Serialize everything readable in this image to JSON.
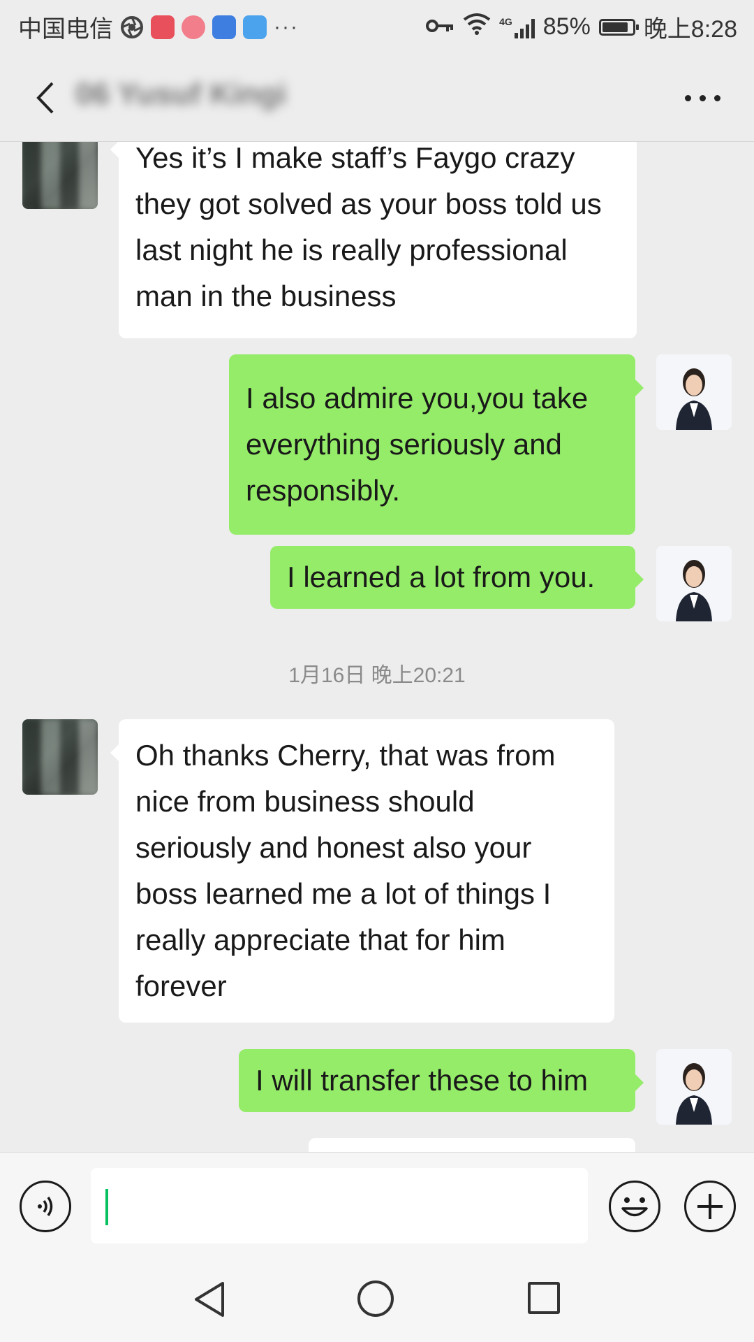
{
  "status_bar": {
    "carrier": "中国电信",
    "battery": "85%",
    "battery_level": 0.85,
    "network": "4G",
    "time": "晚上8:28"
  },
  "header": {
    "title": "06 Yusuf Kingi",
    "back_icon": "chevron-left-icon",
    "more_icon": "more-horizontal-icon"
  },
  "messages": [
    {
      "from": "them",
      "text": "Yes it’s I make staff’s Faygo crazy they got solved as your boss told us last night he is really professional man in the business"
    },
    {
      "from": "me",
      "text": "I also admire you,you take everything seriously and responsibly."
    },
    {
      "from": "me",
      "text": "I learned a lot from you."
    },
    {
      "from": "them",
      "text": "Oh thanks Cherry, that was from nice from business should seriously and honest also your boss learned me a lot of things I really appreciate that for him forever"
    },
    {
      "from": "me",
      "text": "I will transfer these to him"
    }
  ],
  "timestamp": "1月16日 晚上20:21",
  "input": {
    "value": "",
    "voice_icon": "voice-icon",
    "emoji_icon": "emoji-icon",
    "plus_icon": "plus-icon"
  },
  "colors": {
    "outgoing_bubble": "#95ec69",
    "incoming_bubble": "#ffffff",
    "background": "#ededed",
    "caret": "#07c160"
  }
}
